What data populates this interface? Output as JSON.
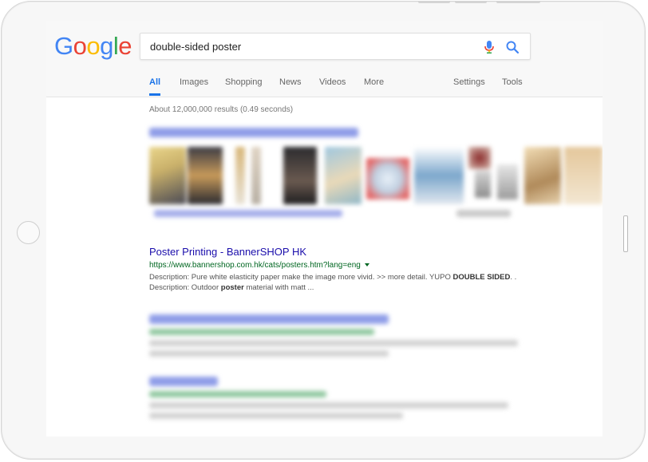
{
  "logo": {
    "letters": [
      "G",
      "o",
      "o",
      "g",
      "l",
      "e"
    ],
    "colors": [
      "#4285F4",
      "#EA4335",
      "#FBBC05",
      "#4285F4",
      "#34A853",
      "#EA4335"
    ]
  },
  "search": {
    "query": "double-sided poster",
    "mic_icon": "microphone-icon",
    "search_icon": "magnifier-icon"
  },
  "tabs": {
    "all": "All",
    "images": "Images",
    "shopping": "Shopping",
    "news": "News",
    "videos": "Videos",
    "more": "More",
    "settings": "Settings",
    "tools": "Tools"
  },
  "stats": "About 12,000,000 results (0.49 seconds)",
  "result": {
    "title": "Poster Printing - BannerSHOP HK",
    "url": "https://www.bannershop.com.hk/cats/posters.htm?lang=eng",
    "desc_1": "Description: Pure white elasticity paper make the image more vivid. >> more detail. YUPO ",
    "desc_bold_1": "DOUBLE SIDED",
    "desc_2": ". . Description: Outdoor ",
    "desc_bold_2": "poster",
    "desc_3": " material with matt ..."
  },
  "colors": {
    "accent": "#1a73e8",
    "link": "#1a0dab",
    "url_green": "#006621",
    "snippet": "#545454"
  }
}
